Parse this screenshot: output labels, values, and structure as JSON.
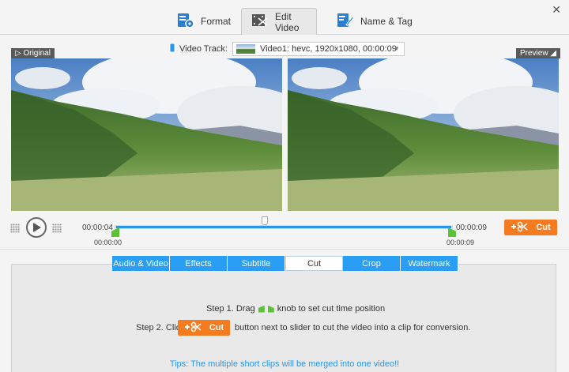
{
  "header": {
    "tabs": [
      {
        "label": "Format",
        "icon": "format-icon"
      },
      {
        "label": "Edit Video",
        "icon": "edit-video-icon",
        "active": true
      },
      {
        "label": "Name & Tag",
        "icon": "name-tag-icon"
      }
    ],
    "close": "✕"
  },
  "track": {
    "label": "Video Track:",
    "value": "Video1: hevc, 1920x1080, 00:00:09"
  },
  "panels": {
    "original": "Original",
    "preview": "Preview"
  },
  "timeline": {
    "current_time": "00:00:04",
    "start_time": "00:00:00",
    "end_time": "00:00:09",
    "end_time_below": "00:00:09",
    "cut_label": "Cut"
  },
  "edit_tabs": [
    "Audio & Video",
    "Effects",
    "Subtitle",
    "Cut",
    "Crop",
    "Watermark"
  ],
  "instructions": {
    "step1_a": "Step 1. Drag",
    "step1_b": "knob to set cut time position",
    "step2_a": "Step 2. Click",
    "step2_b": "button next to slider to cut the video into a clip for conversion.",
    "cut_label": "Cut",
    "tips": "Tips: The multiple short clips will be merged into one video!!"
  },
  "colors": {
    "accent": "#2a9df4",
    "cut": "#f47b20",
    "knob": "#5bc236"
  }
}
